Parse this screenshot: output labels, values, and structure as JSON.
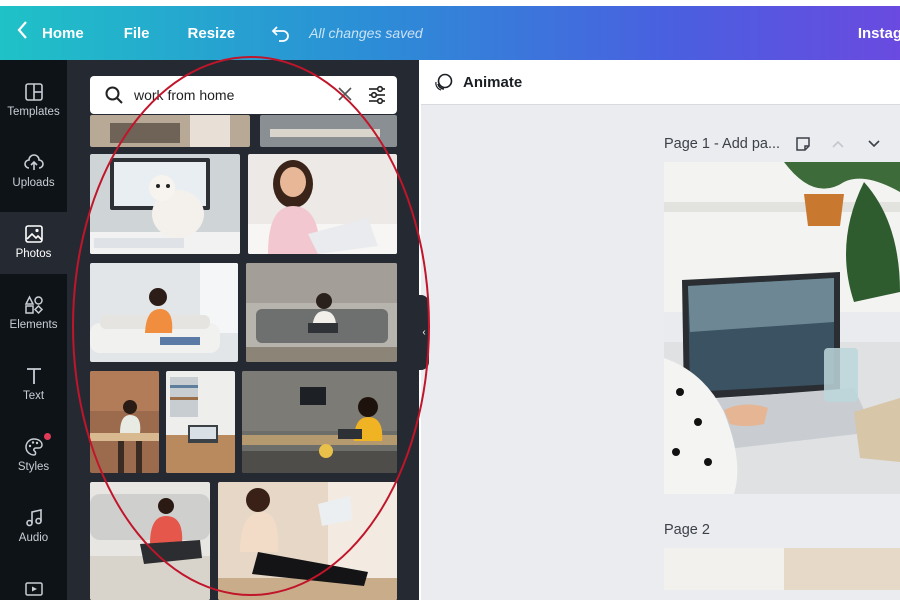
{
  "topbar": {
    "home": "Home",
    "file": "File",
    "resize": "Resize",
    "saved": "All changes saved",
    "right": "Instag"
  },
  "rail": {
    "items": [
      {
        "label": "Templates",
        "icon": "templates-icon"
      },
      {
        "label": "Uploads",
        "icon": "uploads-icon"
      },
      {
        "label": "Photos",
        "icon": "photos-icon"
      },
      {
        "label": "Elements",
        "icon": "elements-icon"
      },
      {
        "label": "Text",
        "icon": "text-icon"
      },
      {
        "label": "Styles",
        "icon": "styles-icon"
      },
      {
        "label": "Audio",
        "icon": "audio-icon"
      },
      {
        "label": "",
        "icon": "video-icon"
      }
    ]
  },
  "search": {
    "value": "work from home"
  },
  "canvas": {
    "animate": "Animate",
    "page1": "Page 1 - Add pa...",
    "page2": "Page 2"
  },
  "colors": {
    "accent_start": "#1fc2c7",
    "accent_end": "#6a4ae0",
    "annotation": "#c0152a",
    "panel": "#252a32"
  }
}
